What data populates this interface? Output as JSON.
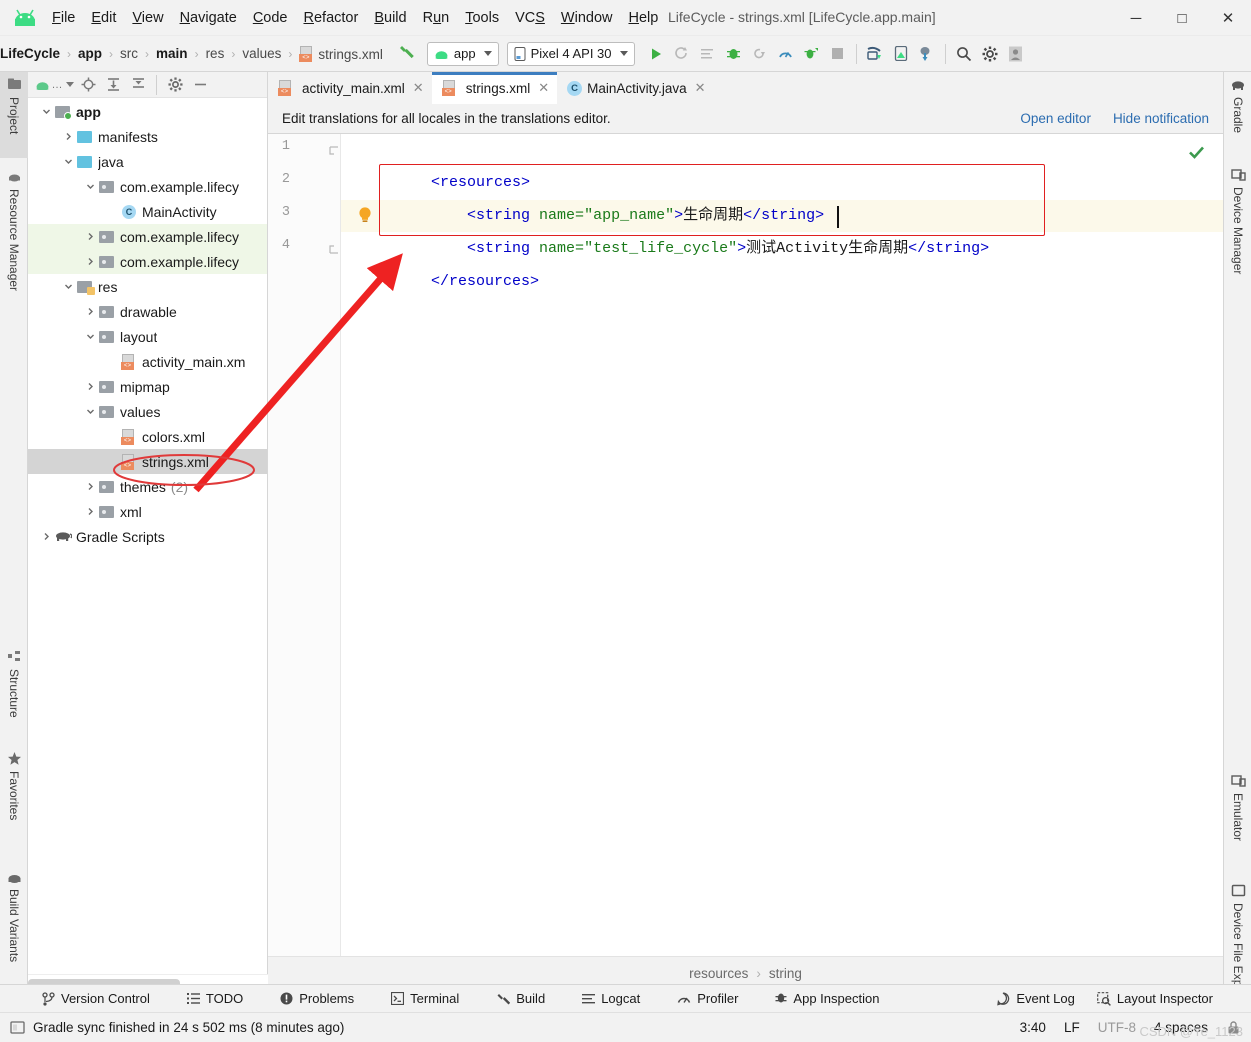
{
  "window": {
    "title": "LifeCycle - strings.xml [LifeCycle.app.main]",
    "minimize_label": "─",
    "maximize_label": "□",
    "close_label": "✕"
  },
  "menubar": {
    "logo_name": "android-logo",
    "items": [
      {
        "label": "File",
        "mnemonic": "F"
      },
      {
        "label": "Edit",
        "mnemonic": "E"
      },
      {
        "label": "View",
        "mnemonic": "V"
      },
      {
        "label": "Navigate",
        "mnemonic": "N"
      },
      {
        "label": "Code",
        "mnemonic": "C"
      },
      {
        "label": "Refactor",
        "mnemonic": "R"
      },
      {
        "label": "Build",
        "mnemonic": "B"
      },
      {
        "label": "Run",
        "mnemonic": "u"
      },
      {
        "label": "Tools",
        "mnemonic": "T"
      },
      {
        "label": "VCS",
        "mnemonic": "S"
      },
      {
        "label": "Window",
        "mnemonic": "W"
      },
      {
        "label": "Help",
        "mnemonic": "H"
      }
    ]
  },
  "navbar": {
    "breadcrumbs": [
      {
        "label": "LifeCycle",
        "bold": true
      },
      {
        "label": "app",
        "bold": true
      },
      {
        "label": "src",
        "bold": false
      },
      {
        "label": "main",
        "bold": true
      },
      {
        "label": "res",
        "bold": false
      },
      {
        "label": "values",
        "bold": false
      },
      {
        "label": "strings.xml",
        "bold": false,
        "icon": "xml-file-icon"
      }
    ],
    "separator": "›",
    "module_selector": "app",
    "device_selector": "Pixel 4 API 30",
    "buttons": [
      "build-hammer-icon",
      "run-icon",
      "apply-changes-icon",
      "apply-code-changes-icon",
      "debug-icon",
      "attach-debugger-icon",
      "profiler-icon",
      "run-with-coverage-icon",
      "stop-icon",
      "avd-manager-icon",
      "sdk-manager-icon",
      "sync-gradle-icon",
      "search-everywhere-icon",
      "settings-icon",
      "account-icon"
    ]
  },
  "left_stripe": {
    "tabs": [
      {
        "label": "Project",
        "icon": "project-folder-icon",
        "selected": true
      },
      {
        "label": "Resource Manager",
        "icon": "resource-manager-icon",
        "selected": false
      },
      {
        "label": "Structure",
        "icon": "structure-icon",
        "selected": false
      },
      {
        "label": "Favorites",
        "icon": "star-icon",
        "selected": false
      },
      {
        "label": "Build Variants",
        "icon": "build-variants-icon",
        "selected": false
      }
    ]
  },
  "right_stripe": {
    "tabs": [
      {
        "label": "Gradle",
        "icon": "gradle-elephant-icon"
      },
      {
        "label": "Device Manager",
        "icon": "device-manager-icon"
      },
      {
        "label": "Emulator",
        "icon": "emulator-icon"
      },
      {
        "label": "Device File Explorer",
        "icon": "device-file-explorer-icon"
      }
    ]
  },
  "project_panel": {
    "header_buttons": [
      "android-view-selector",
      "locate-icon",
      "expand-all-icon",
      "collapse-all-icon",
      "settings-gear-icon",
      "hide-panel-icon"
    ],
    "tree": [
      {
        "label": "app",
        "depth": 0,
        "chev": "down",
        "icon": "module-folder-icon",
        "bold": true,
        "bg": "none"
      },
      {
        "label": "manifests",
        "depth": 1,
        "chev": "right",
        "icon": "folder-blue-icon",
        "bold": false,
        "bg": "none"
      },
      {
        "label": "java",
        "depth": 1,
        "chev": "down",
        "icon": "folder-blue-icon",
        "bold": false,
        "bg": "none"
      },
      {
        "label": "com.example.lifecy",
        "depth": 2,
        "chev": "down",
        "icon": "package-folder-icon",
        "bold": false,
        "bg": "none"
      },
      {
        "label": "MainActivity",
        "depth": 3,
        "chev": "none",
        "icon": "java-class-icon",
        "bold": false,
        "bg": "none"
      },
      {
        "label": "com.example.lifecy",
        "depth": 2,
        "chev": "right",
        "icon": "package-folder-icon",
        "bold": false,
        "bg": "green"
      },
      {
        "label": "com.example.lifecy",
        "depth": 2,
        "chev": "right",
        "icon": "package-folder-icon",
        "bold": false,
        "bg": "green"
      },
      {
        "label": "res",
        "depth": 1,
        "chev": "down",
        "icon": "res-folder-icon",
        "bold": false,
        "bg": "none"
      },
      {
        "label": "drawable",
        "depth": 2,
        "chev": "right",
        "icon": "package-folder-icon",
        "bold": false,
        "bg": "none"
      },
      {
        "label": "layout",
        "depth": 2,
        "chev": "down",
        "icon": "package-folder-icon",
        "bold": false,
        "bg": "none"
      },
      {
        "label": "activity_main.xm",
        "depth": 3,
        "chev": "none",
        "icon": "xml-file-icon",
        "bold": false,
        "bg": "none"
      },
      {
        "label": "mipmap",
        "depth": 2,
        "chev": "right",
        "icon": "package-folder-icon",
        "bold": false,
        "bg": "none"
      },
      {
        "label": "values",
        "depth": 2,
        "chev": "down",
        "icon": "package-folder-icon",
        "bold": false,
        "bg": "none"
      },
      {
        "label": "colors.xml",
        "depth": 3,
        "chev": "none",
        "icon": "xml-file-icon",
        "bold": false,
        "bg": "none"
      },
      {
        "label": "strings.xml",
        "depth": 3,
        "chev": "none",
        "icon": "xml-file-icon",
        "bold": false,
        "bg": "selected"
      },
      {
        "label": "themes",
        "suffix": " (2)",
        "depth": 2,
        "chev": "right",
        "icon": "package-folder-icon",
        "bold": false,
        "bg": "none"
      },
      {
        "label": "xml",
        "depth": 2,
        "chev": "right",
        "icon": "package-folder-icon",
        "bold": false,
        "bg": "none"
      },
      {
        "label": "Gradle Scripts",
        "depth": 0,
        "chev": "right",
        "icon": "gradle-elephant-icon",
        "bold": false,
        "bg": "none"
      }
    ]
  },
  "editor": {
    "tabs": [
      {
        "label": "activity_main.xml",
        "icon": "xml-file-icon",
        "active": false,
        "close": "✕"
      },
      {
        "label": "strings.xml",
        "icon": "xml-file-icon",
        "active": true,
        "close": "✕"
      },
      {
        "label": "MainActivity.java",
        "icon": "java-class-icon",
        "active": false,
        "close": "✕"
      }
    ],
    "notification": {
      "text": "Edit translations for all locales in the translations editor.",
      "open_editor": "Open editor",
      "hide_notification": "Hide notification"
    },
    "line_numbers": [
      "1",
      "2",
      "3",
      "4"
    ],
    "code_lines": [
      {
        "num": "1",
        "segments": [
          {
            "t": "<resources>",
            "c": "tag"
          }
        ]
      },
      {
        "num": "2",
        "segments": [
          {
            "t": "    <string ",
            "c": "tag"
          },
          {
            "t": "name=",
            "c": "attr"
          },
          {
            "t": "\"app_name\"",
            "c": "val"
          },
          {
            "t": ">",
            "c": "tag"
          },
          {
            "t": "生命周期",
            "c": "txt"
          },
          {
            "t": "</string>",
            "c": "tag"
          }
        ]
      },
      {
        "num": "3",
        "segments": [
          {
            "t": "    <string ",
            "c": "tag"
          },
          {
            "t": "name=",
            "c": "attr"
          },
          {
            "t": "\"test_life_cycle\"",
            "c": "val"
          },
          {
            "t": ">",
            "c": "tag"
          },
          {
            "t": "测试Activity生命周期",
            "c": "txt"
          },
          {
            "t": "</string>",
            "c": "tag"
          }
        ]
      },
      {
        "num": "4",
        "segments": [
          {
            "t": "</resources>",
            "c": "tag"
          }
        ]
      }
    ],
    "gutter_icons": [
      {
        "line": 3,
        "icon": "intention-bulb-icon"
      }
    ],
    "inspection_status": "no-errors-checkmark",
    "breadcrumbs": [
      "resources",
      "string"
    ],
    "breadcrumb_sep": "›"
  },
  "annotations": {
    "arrow": {
      "name": "red-arrow-annotation",
      "color": "#ee2222"
    },
    "ellipse": {
      "name": "red-ellipse-annotation",
      "color": "#ee2222",
      "target": "strings.xml"
    }
  },
  "toolwindow_bar": {
    "left": [
      {
        "label": "Version Control",
        "icon": "version-control-icon"
      },
      {
        "label": "TODO",
        "icon": "todo-icon"
      },
      {
        "label": "Problems",
        "icon": "problems-icon"
      },
      {
        "label": "Terminal",
        "icon": "terminal-icon"
      },
      {
        "label": "Build",
        "icon": "build-hammer-icon"
      },
      {
        "label": "Logcat",
        "icon": "logcat-icon"
      },
      {
        "label": "Profiler",
        "icon": "profiler-icon"
      },
      {
        "label": "App Inspection",
        "icon": "app-inspection-icon"
      }
    ],
    "right": [
      {
        "label": "Event Log",
        "icon": "event-log-icon"
      },
      {
        "label": "Layout Inspector",
        "icon": "layout-inspector-icon"
      }
    ]
  },
  "statusbar": {
    "message": "Gradle sync finished in 24 s 502 ms (8 minutes ago)",
    "message_icon": "notification-icon",
    "caret_position": "3:40",
    "line_separator": "LF",
    "encoding": "UTF-8",
    "indent": "4 spaces",
    "watermark": "CSDN @Ye_1123"
  },
  "colors": {
    "accent_blue": "#3d7ec0",
    "link_blue": "#2b6cb0",
    "annotation_red": "#ee2222",
    "tag_blue": "#0000c8",
    "attr_green": "#1a7a1a",
    "highlight_row": "#fcf9ea",
    "test_source_green": "#eff7e7",
    "selected_gray": "#d4d4d4"
  }
}
